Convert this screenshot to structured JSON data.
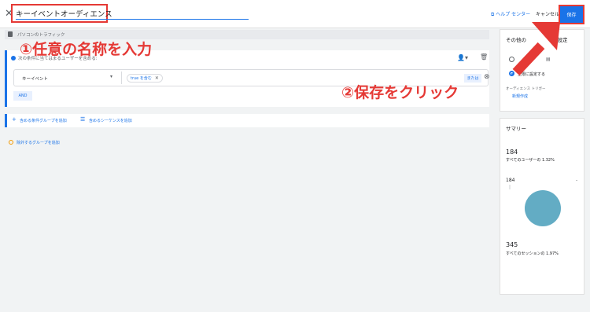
{
  "header": {
    "close_icon": "close-icon",
    "audience_name": "キーイベントオーディエンス",
    "help_label": "ヘルプ センター",
    "cancel_label": "キャンセル",
    "save_label": "保存"
  },
  "traffic": {
    "text": "パソコンのトラフィック"
  },
  "condition_group": {
    "header": "次の条件に当てはまるユーザーを含める:",
    "event_label": "キーイベント",
    "chip_label": "true を含む",
    "or_label": "または",
    "and_label": "AND"
  },
  "add_row": {
    "add_group": "含める条件グループを追加",
    "add_sequence": "含めるシーケンスを追加"
  },
  "exclude": {
    "label": "除外するグループを追加"
  },
  "annotations": {
    "step1": "①任意の名称を入力",
    "step2": "②保存をクリック"
  },
  "settings_panel": {
    "title_part1": "その他の",
    "title_part2": "ス設定",
    "max_label": "上限に設定する",
    "trigger_label": "オーディエンス トリガー",
    "new_create": "新規作成"
  },
  "summary": {
    "title": "サマリー",
    "users_value": "184",
    "users_pct": "すべてのユーザーの 1.32%",
    "chart_value": "184",
    "chart_dash": "-",
    "sessions_value": "345",
    "sessions_pct": "すべてのセッションの 1.97%"
  },
  "colors": {
    "accent": "#1a73e8",
    "annotation_red": "#e53935",
    "pie": "#63acc4"
  }
}
